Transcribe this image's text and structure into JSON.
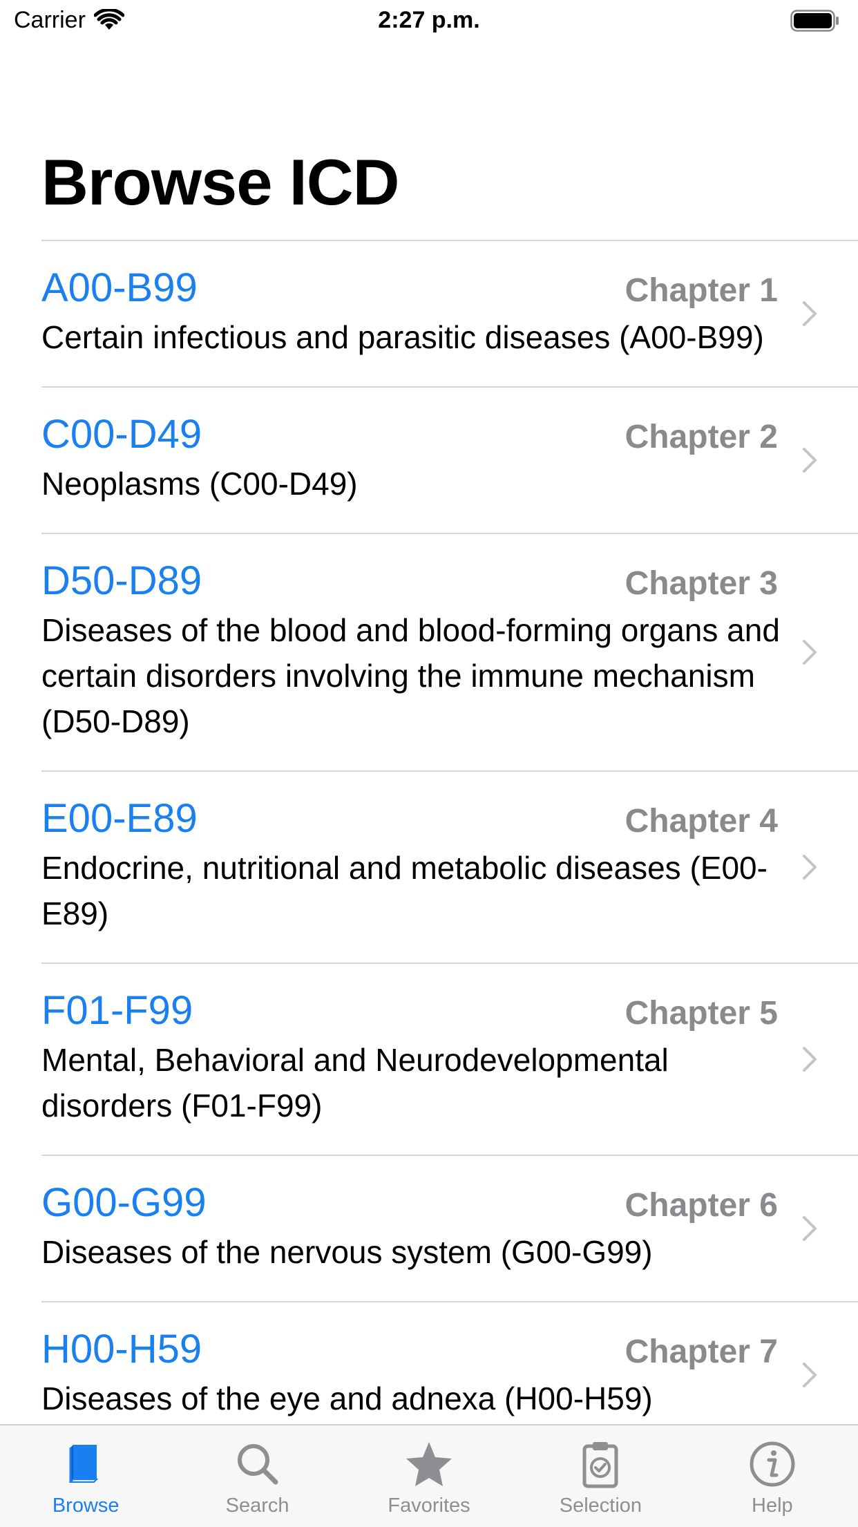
{
  "status_bar": {
    "carrier": "Carrier",
    "time": "2:27 p.m."
  },
  "title": "Browse ICD",
  "chapters": [
    {
      "code": "A00-B99",
      "chapter": "Chapter 1",
      "description": "Certain infectious and parasitic diseases (A00-B99)"
    },
    {
      "code": "C00-D49",
      "chapter": "Chapter 2",
      "description": "Neoplasms (C00-D49)"
    },
    {
      "code": "D50-D89",
      "chapter": "Chapter 3",
      "description": "Diseases of the blood and blood-forming organs and certain disorders involving the immune mechanism (D50-D89)"
    },
    {
      "code": "E00-E89",
      "chapter": "Chapter 4",
      "description": "Endocrine, nutritional and metabolic diseases (E00-E89)"
    },
    {
      "code": "F01-F99",
      "chapter": "Chapter 5",
      "description": "Mental, Behavioral and Neurodevelopmental disorders (F01-F99)"
    },
    {
      "code": "G00-G99",
      "chapter": "Chapter 6",
      "description": "Diseases of the nervous system (G00-G99)"
    },
    {
      "code": "H00-H59",
      "chapter": "Chapter 7",
      "description": "Diseases of the eye and adnexa (H00-H59)"
    }
  ],
  "tabs": [
    {
      "label": "Browse",
      "icon": "book-icon",
      "active": true
    },
    {
      "label": "Search",
      "icon": "magnifier-icon",
      "active": false
    },
    {
      "label": "Favorites",
      "icon": "star-icon",
      "active": false
    },
    {
      "label": "Selection",
      "icon": "clipboard-check-icon",
      "active": false
    },
    {
      "label": "Help",
      "icon": "info-icon",
      "active": false
    }
  ],
  "colors": {
    "accent": "#1a7ff0",
    "secondary_text": "#8a8a8e",
    "inactive_tab": "#8e8e93"
  }
}
